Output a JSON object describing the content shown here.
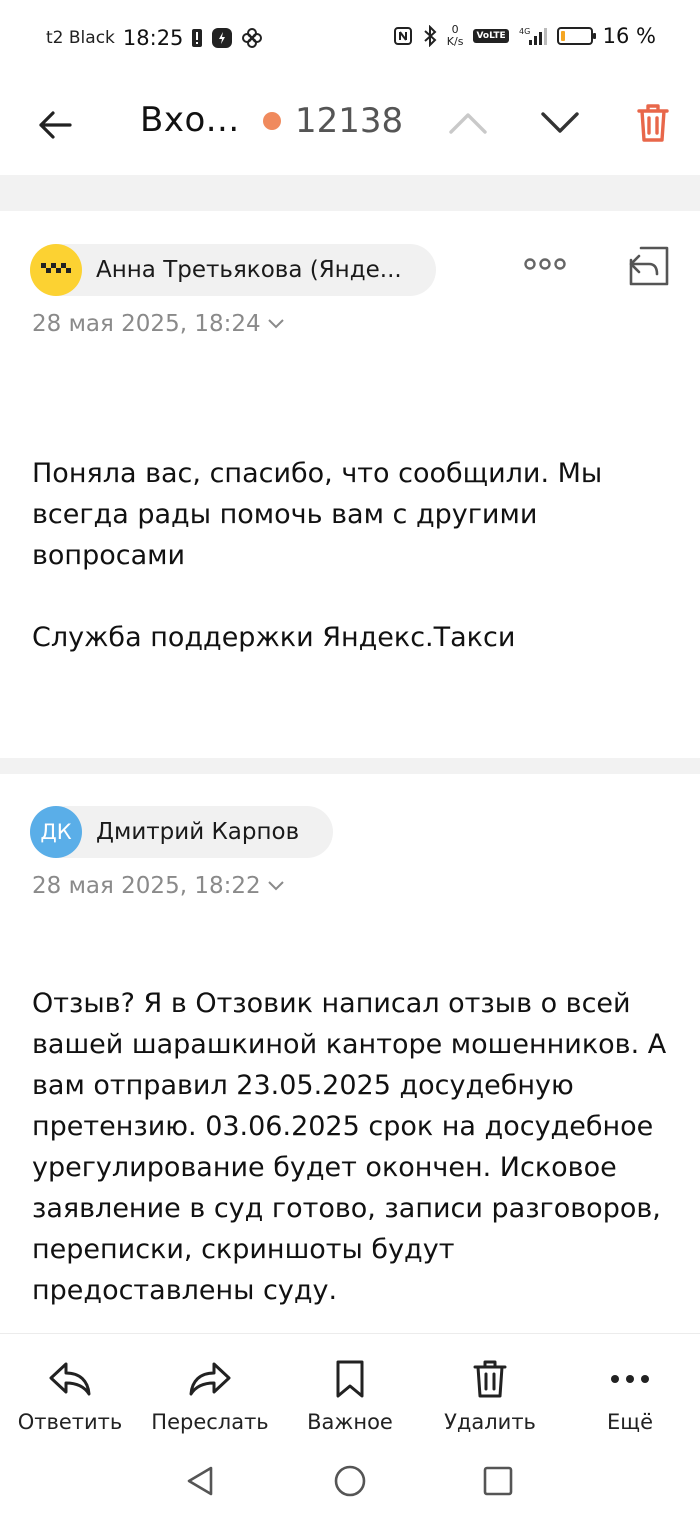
{
  "status_bar": {
    "carrier": "t2 Black",
    "time": "18:25",
    "net_speed_value": "0",
    "net_speed_unit": "K/s",
    "network": "4G",
    "volte": "VoLTE",
    "battery_percent": "16 %",
    "battery_level": 0.16,
    "battery_color": "#f5a623"
  },
  "header": {
    "folder_title": "Вхо...",
    "unread_count": "12138",
    "unread_dot_color": "#f08a5d",
    "trash_color": "#e8674a"
  },
  "messages": [
    {
      "sender": "Анна Третьякова (Янде...",
      "avatar": "taxi-logo-icon",
      "avatar_color": "#fcd232",
      "date": "28 мая 2025, 18:24",
      "body": [
        "Поняла вас, спасибо, что сообщили. Мы всегда рады помочь вам с другими вопросами",
        "Служба поддержки Яндекс.Такси"
      ]
    },
    {
      "sender": "Дмитрий Карпов",
      "avatar_initials": "ДК",
      "avatar_color": "#5aaee8",
      "date": "28 мая 2025, 18:22",
      "body": [
        "Отзыв? Я в Отзовик написал отзыв о всей вашей шарашкиной канторе мошенников. А вам отправил 23.05.2025 досудебную претензию. 03.06.2025 срок на досудебное урегулирование будет окончен. Исковое заявление в суд готово, записи разговоров, переписки, скриншоты будут предоставлены суду."
      ]
    }
  ],
  "actions": {
    "reply": "Ответить",
    "forward": "Переслать",
    "important": "Важное",
    "delete": "Удалить",
    "more": "Ещё"
  }
}
